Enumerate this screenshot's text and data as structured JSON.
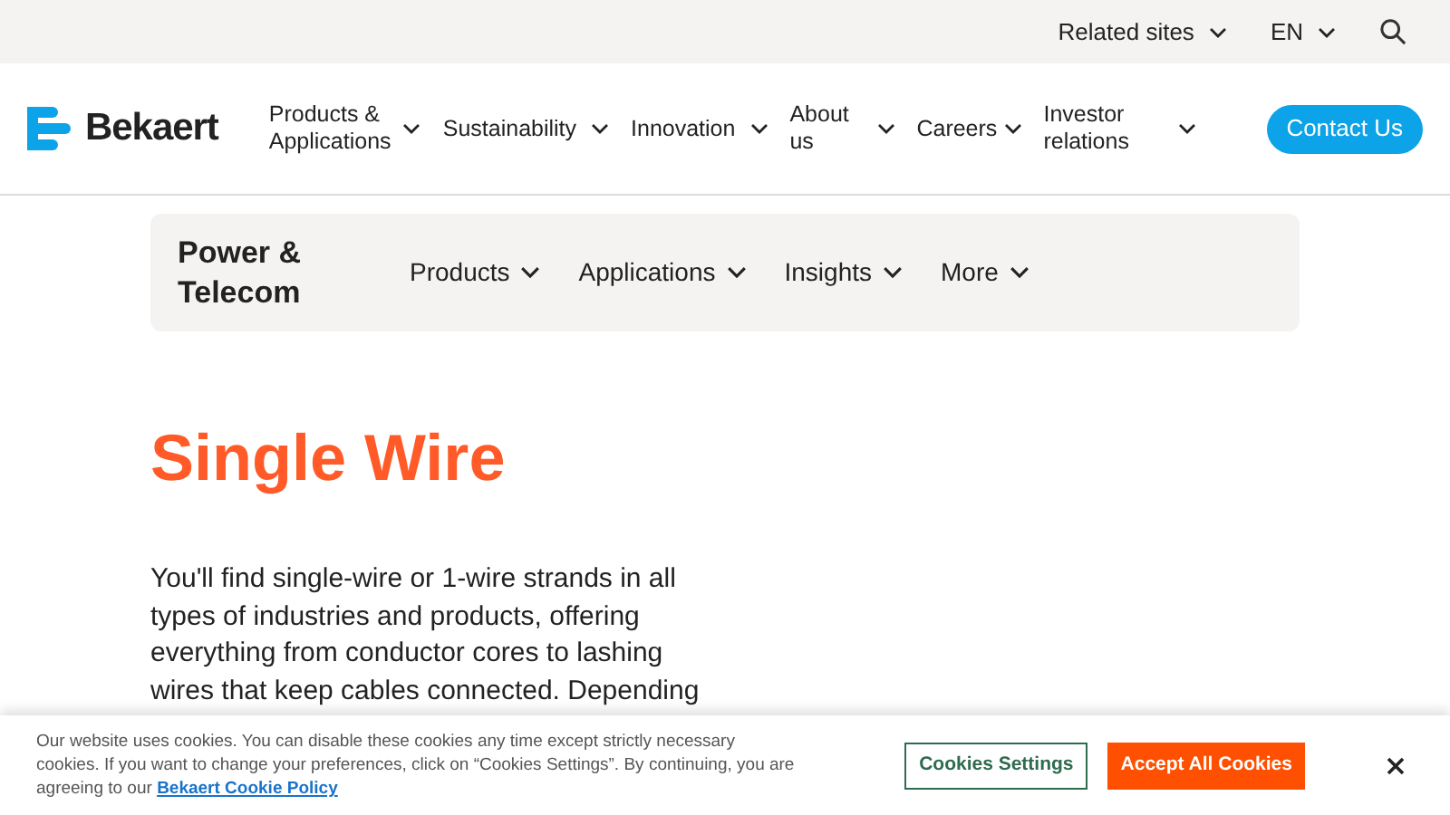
{
  "utility_bar": {
    "items": [
      {
        "label": "Related sites"
      },
      {
        "label": "EN"
      }
    ]
  },
  "header": {
    "logo": "Bekaert",
    "nav": [
      {
        "label": "Products & Applications"
      },
      {
        "label": "Sustainability"
      },
      {
        "label": "Innovation"
      },
      {
        "label": "About us"
      },
      {
        "label": "Careers"
      },
      {
        "label": "Investor relations"
      }
    ],
    "cta": "Contact Us"
  },
  "section_nav": {
    "title": "Power & Telecom",
    "items": [
      {
        "label": "Products"
      },
      {
        "label": "Applications"
      },
      {
        "label": "Insights"
      },
      {
        "label": "More"
      }
    ]
  },
  "page": {
    "title": "Single Wire",
    "intro": "You'll find single-wire or 1-wire strands in all types of industries and products, offering everything from conductor cores to lashing wires that keep cables connected. Depending"
  },
  "cookie_banner": {
    "text": "Our website uses cookies. You can disable these cookies any time except strictly necessary cookies. If you want to change your preferences, click on “Cookies Settings”. By continuing, you are agreeing to our",
    "link": "Bekaert Cookie Policy",
    "buttons": [
      {
        "label": "Cookies Settings",
        "kind": "secondary"
      },
      {
        "label": "Accept All Cookies",
        "kind": "primary"
      }
    ]
  }
}
